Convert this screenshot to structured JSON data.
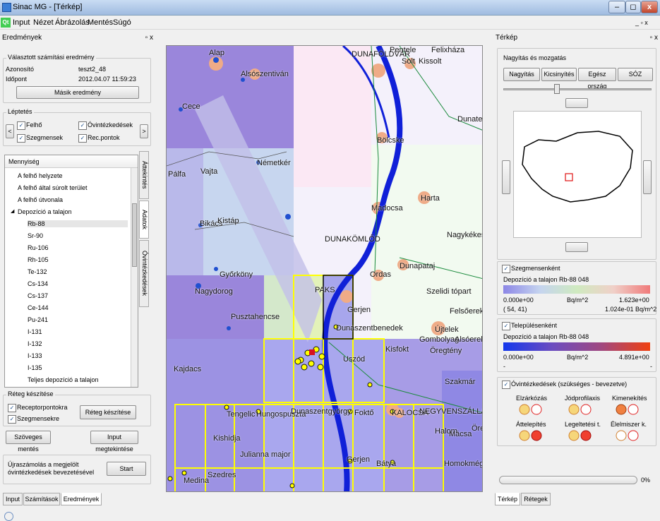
{
  "window": {
    "title": "Sinac MG - [Térkép]",
    "min": "–",
    "max": "◻",
    "close": "x"
  },
  "menu": [
    "Input",
    "Nézet",
    "Ábrázolás",
    "Mentés",
    "Súgó"
  ],
  "left_dock": {
    "title": "Eredmények",
    "selected": {
      "header": "Választott számítási eredmény",
      "id_label": "Azonosító",
      "id_value": "teszt2_48",
      "time_label": "Időpont",
      "time_value": "2012.04.07 11:59:23",
      "other_button": "Másik eredmény"
    },
    "step": {
      "header": "Léptetés",
      "prev": "<",
      "next": ">",
      "checks": [
        "Felhő",
        "Óvintézkedések",
        "Szegmensek",
        "Rec.pontok"
      ]
    },
    "tree": {
      "header": "Mennyiség",
      "items": [
        "A felhő helyzete",
        "A felhő által súrolt terület",
        "A felhő útvonala",
        "Depozíció a talajon",
        "Rb-88",
        "Sr-90",
        "Ru-106",
        "Rh-105",
        "Te-132",
        "Cs-134",
        "Cs-137",
        "Ce-144",
        "Pu-241",
        "I-131",
        "I-132",
        "I-133",
        "I-135",
        "Teljes depozíció a talajon"
      ]
    },
    "side_tabs": [
      "Áttekintés",
      "Adatok",
      "Óvintézkedések"
    ],
    "layer": {
      "header": "Réteg készítése",
      "checks": [
        "Receptorpontokra",
        "Szegmensekre"
      ],
      "make_button": "Réteg készítése"
    },
    "save_text": "Szöveges mentés",
    "view_input": "Input megtekintése",
    "recalc_text": "Újraszámolás a megjelölt óvintézkedések bevezetésével",
    "start": "Start"
  },
  "bottom_tabs": [
    "Input",
    "Számítások",
    "Eredmények"
  ],
  "map_labels": [
    "Alap",
    "Alsószentiván",
    "Cece",
    "DUNAFÖLDVÁR",
    "Solt",
    "Kissolt",
    "Pentele",
    "Felixháza",
    "Pálfa",
    "Vajta",
    "Németkér",
    "Dunate",
    "Bölcske",
    "Madocsa",
    "Harta",
    "Bikács",
    "Kistáp",
    "DUNAKÖMLŐD",
    "Nagykékes",
    "Győrköny",
    "Nagydorog",
    "Pusztahencse",
    "PAKS",
    "Ordas",
    "Dunapataj",
    "Szelidi tópart",
    "Gerjen",
    "Dunaszentbenedek",
    "Felsőerek",
    "Újtelek",
    "Gombolyag",
    "Alsóerek",
    "Öregtény",
    "Kisfokt",
    "Kajdacs",
    "Uszód",
    "Szakmár",
    "Tengelic",
    "Hungospuszta",
    "Dunaszentgyörgy",
    "Foktő",
    "KALOCSA",
    "NEGYVENSZÁLLÁS",
    "Halom",
    "Öreg",
    "Kishidja",
    "Julianna major",
    "Gerjen",
    "Bátya",
    "Homokmégy",
    "Medina",
    "Szedres",
    "Mácsa"
  ],
  "right_dock": {
    "title": "Térkép",
    "nav": {
      "header": "Nagyítás és mozgatás",
      "buttons": [
        "Nagyítás",
        "Kicsinyítés",
        "Egész ország",
        "SÓZ"
      ]
    },
    "segments": {
      "header": "Szegmensenként",
      "subtitle": "Depozíció a talajon Rb-88  048",
      "min": "0.000e+00",
      "unit": "Bq/m^2",
      "max": "1.623e+00",
      "pos": "( 54, 41)",
      "value": "1.024e-01 Bq/m^2"
    },
    "settlements": {
      "header": "Településenként",
      "subtitle": "Depozíció a talajon Rb-88  048",
      "min": "0.000e+00",
      "unit": "Bq/m^2",
      "max": "4.891e+00",
      "dash1": "-",
      "dash2": "-"
    },
    "measures": {
      "header": "Óvintézkedések (szükséges - bevezetve)",
      "labels": [
        "Elzárkózás",
        "Jódprofilaxis",
        "Kimenekítés",
        "Áttelepítés",
        "Legeltetési t.",
        "Élelmiszer k."
      ]
    },
    "progress": "0%",
    "progress_value": 0,
    "tabs": [
      "Térkép",
      "Rétegek"
    ]
  },
  "colors": {
    "map_low": "#8c86e6",
    "map_high": "#f07a7a",
    "settle_low": "#2a3fe0",
    "settle_high": "#f04010",
    "river": "#1020d8",
    "grid": "#ffff00"
  }
}
